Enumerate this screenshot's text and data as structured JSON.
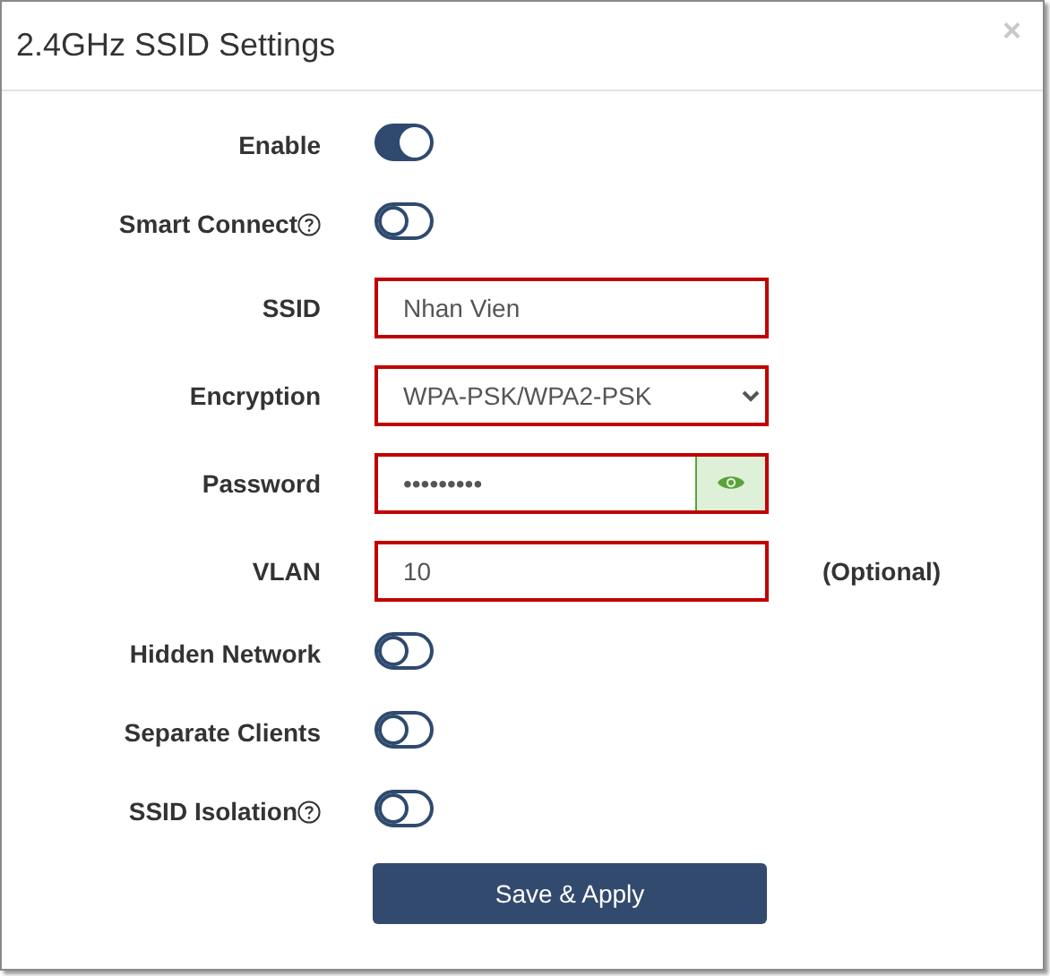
{
  "dialog": {
    "title": "2.4GHz SSID Settings",
    "close": "×"
  },
  "fields": [
    {
      "kind": "toggle",
      "label": "Enable",
      "help": false,
      "on": true
    },
    {
      "kind": "toggle",
      "label": "Smart Connect",
      "help": true,
      "on": false
    },
    {
      "kind": "text",
      "label": "SSID",
      "value": "Nhan Vien"
    },
    {
      "kind": "select",
      "label": "Encryption",
      "value": "WPA-PSK/WPA2-PSK"
    },
    {
      "kind": "password",
      "label": "Password",
      "value": "•••••••••"
    },
    {
      "kind": "text",
      "label": "VLAN",
      "value": "10",
      "note": "(Optional)"
    },
    {
      "kind": "toggle",
      "label": "Hidden Network",
      "help": false,
      "on": false
    },
    {
      "kind": "toggle",
      "label": "Separate Clients",
      "help": false,
      "on": false
    },
    {
      "kind": "toggle",
      "label": "SSID Isolation",
      "help": true,
      "on": false
    }
  ],
  "button": "Save & Apply"
}
